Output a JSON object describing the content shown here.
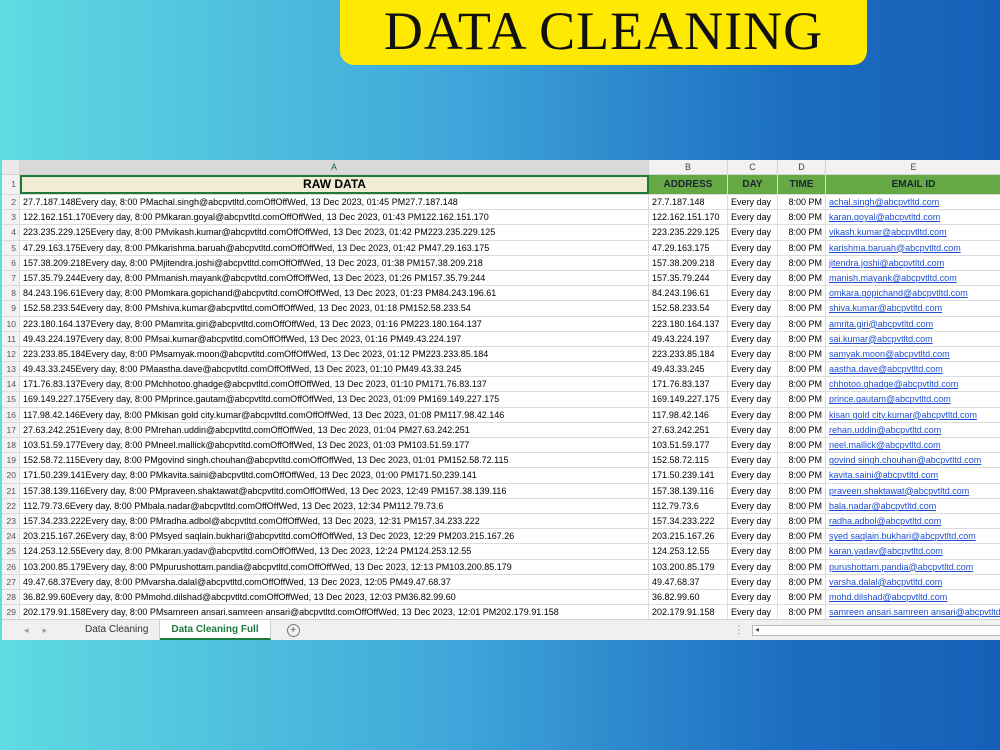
{
  "banner": {
    "title": "DATA CLEANING"
  },
  "columns": [
    "A",
    "B",
    "C",
    "D",
    "E"
  ],
  "header_row": {
    "number": "1",
    "raw": "RAW DATA",
    "address": "ADDRESS",
    "day": "DAY",
    "time": "TIME",
    "email": "EMAIL ID"
  },
  "rows": [
    {
      "n": "2",
      "raw": "27.7.187.148Every day, 8:00 PMachal.singh@abcpvtltd.comOffOffWed, 13 Dec 2023, 01:45 PM27.7.187.148",
      "address": "27.7.187.148",
      "day": "Every day",
      "time": "8:00 PM",
      "email": "achal.singh@abcpvtltd.com"
    },
    {
      "n": "3",
      "raw": "122.162.151.170Every day, 8:00 PMkaran.goyal@abcpvtltd.comOffOffWed, 13 Dec 2023, 01:43 PM122.162.151.170",
      "address": "122.162.151.170",
      "day": "Every day",
      "time": "8:00 PM",
      "email": "karan.goyal@abcpvtltd.com"
    },
    {
      "n": "4",
      "raw": "223.235.229.125Every day, 8:00 PMvikash.kumar@abcpvtltd.comOffOffWed, 13 Dec 2023, 01:42 PM223.235.229.125",
      "address": "223.235.229.125",
      "day": "Every day",
      "time": "8:00 PM",
      "email": "vikash.kumar@abcpvtltd.com"
    },
    {
      "n": "5",
      "raw": "47.29.163.175Every day, 8:00 PMkarishma.baruah@abcpvtltd.comOffOffWed, 13 Dec 2023, 01:42 PM47.29.163.175",
      "address": "47.29.163.175",
      "day": "Every day",
      "time": "8:00 PM",
      "email": "karishma.baruah@abcpvtltd.com"
    },
    {
      "n": "6",
      "raw": "157.38.209.218Every day, 8:00 PMjitendra.joshi@abcpvtltd.comOffOffWed, 13 Dec 2023, 01:38 PM157.38.209.218",
      "address": "157.38.209.218",
      "day": "Every day",
      "time": "8:00 PM",
      "email": "jitendra.joshi@abcpvtltd.com"
    },
    {
      "n": "7",
      "raw": "157.35.79.244Every day, 8:00 PMmanish.mayank@abcpvtltd.comOffOffWed, 13 Dec 2023, 01:26 PM157.35.79.244",
      "address": "157.35.79.244",
      "day": "Every day",
      "time": "8:00 PM",
      "email": "manish.mayank@abcpvtltd.com"
    },
    {
      "n": "8",
      "raw": "84.243.196.61Every day, 8:00 PMomkara.gopichand@abcpvtltd.comOffOffWed, 13 Dec 2023, 01:23 PM84.243.196.61",
      "address": "84.243.196.61",
      "day": "Every day",
      "time": "8:00 PM",
      "email": "omkara.gopichand@abcpvtltd.com"
    },
    {
      "n": "9",
      "raw": "152.58.233.54Every day, 8:00 PMshiva.kumar@abcpvtltd.comOffOffWed, 13 Dec 2023, 01:18 PM152.58.233.54",
      "address": "152.58.233.54",
      "day": "Every day",
      "time": "8:00 PM",
      "email": "shiva.kumar@abcpvtltd.com"
    },
    {
      "n": "10",
      "raw": "223.180.164.137Every day, 8:00 PMamrita.giri@abcpvtltd.comOffOffWed, 13 Dec 2023, 01:16 PM223.180.164.137",
      "address": "223.180.164.137",
      "day": "Every day",
      "time": "8:00 PM",
      "email": "amrita.giri@abcpvtltd.com"
    },
    {
      "n": "11",
      "raw": "49.43.224.197Every day, 8:00 PMsai.kumar@abcpvtltd.comOffOffWed, 13 Dec 2023, 01:16 PM49.43.224.197",
      "address": "49.43.224.197",
      "day": "Every day",
      "time": "8:00 PM",
      "email": "sai.kumar@abcpvtltd.com"
    },
    {
      "n": "12",
      "raw": "223.233.85.184Every day, 8:00 PMsamyak.moon@abcpvtltd.comOffOffWed, 13 Dec 2023, 01:12 PM223.233.85.184",
      "address": "223.233.85.184",
      "day": "Every day",
      "time": "8:00 PM",
      "email": "samyak.moon@abcpvtltd.com"
    },
    {
      "n": "13",
      "raw": "49.43.33.245Every day, 8:00 PMaastha.dave@abcpvtltd.comOffOffWed, 13 Dec 2023, 01:10 PM49.43.33.245",
      "address": "49.43.33.245",
      "day": "Every day",
      "time": "8:00 PM",
      "email": "aastha.dave@abcpvtltd.com"
    },
    {
      "n": "14",
      "raw": "171.76.83.137Every day, 8:00 PMchhotoo.ghadge@abcpvtltd.comOffOffWed, 13 Dec 2023, 01:10 PM171.76.83.137",
      "address": "171.76.83.137",
      "day": "Every day",
      "time": "8:00 PM",
      "email": "chhotoo.ghadge@abcpvtltd.com"
    },
    {
      "n": "15",
      "raw": "169.149.227.175Every day, 8:00 PMprince.gautam@abcpvtltd.comOffOffWed, 13 Dec 2023, 01:09 PM169.149.227.175",
      "address": "169.149.227.175",
      "day": "Every day",
      "time": "8:00 PM",
      "email": "prince.gautam@abcpvtltd.com"
    },
    {
      "n": "16",
      "raw": "117.98.42.146Every day, 8:00 PMkisan gold city.kumar@abcpvtltd.comOffOffWed, 13 Dec 2023, 01:08 PM117.98.42.146",
      "address": "117.98.42.146",
      "day": "Every day",
      "time": "8:00 PM",
      "email": "kisan gold city.kumar@abcpvtltd.com"
    },
    {
      "n": "17",
      "raw": "27.63.242.251Every day, 8:00 PMrehan.uddin@abcpvtltd.comOffOffWed, 13 Dec 2023, 01:04 PM27.63.242.251",
      "address": "27.63.242.251",
      "day": "Every day",
      "time": "8:00 PM",
      "email": "rehan.uddin@abcpvtltd.com"
    },
    {
      "n": "18",
      "raw": "103.51.59.177Every day, 8:00 PMneel.mallick@abcpvtltd.comOffOffWed, 13 Dec 2023, 01:03 PM103.51.59.177",
      "address": "103.51.59.177",
      "day": "Every day",
      "time": "8:00 PM",
      "email": "neel.mallick@abcpvtltd.com"
    },
    {
      "n": "19",
      "raw": "152.58.72.115Every day, 8:00 PMgovind singh.chouhan@abcpvtltd.comOffOffWed, 13 Dec 2023, 01:01 PM152.58.72.115",
      "address": "152.58.72.115",
      "day": "Every day",
      "time": "8:00 PM",
      "email": "govind singh.chouhan@abcpvtltd.com"
    },
    {
      "n": "20",
      "raw": "171.50.239.141Every day, 8:00 PMkavita.saini@abcpvtltd.comOffOffWed, 13 Dec 2023, 01:00 PM171.50.239.141",
      "address": "171.50.239.141",
      "day": "Every day",
      "time": "8:00 PM",
      "email": "kavita.saini@abcpvtltd.com"
    },
    {
      "n": "21",
      "raw": "157.38.139.116Every day, 8:00 PMpraveen.shaktawat@abcpvtltd.comOffOffWed, 13 Dec 2023, 12:49 PM157.38.139.116",
      "address": "157.38.139.116",
      "day": "Every day",
      "time": "8:00 PM",
      "email": "praveen.shaktawat@abcpvtltd.com"
    },
    {
      "n": "22",
      "raw": "112.79.73.6Every day, 8:00 PMbala.nadar@abcpvtltd.comOffOffWed, 13 Dec 2023, 12:34 PM112.79.73.6",
      "address": "112.79.73.6",
      "day": "Every day",
      "time": "8:00 PM",
      "email": "bala.nadar@abcpvtltd.com"
    },
    {
      "n": "23",
      "raw": "157.34.233.222Every day, 8:00 PMradha.adbol@abcpvtltd.comOffOffWed, 13 Dec 2023, 12:31 PM157.34.233.222",
      "address": "157.34.233.222",
      "day": "Every day",
      "time": "8:00 PM",
      "email": "radha.adbol@abcpvtltd.com"
    },
    {
      "n": "24",
      "raw": "203.215.167.26Every day, 8:00 PMsyed saqlain.bukhari@abcpvtltd.comOffOffWed, 13 Dec 2023, 12:29 PM203.215.167.26",
      "address": "203.215.167.26",
      "day": "Every day",
      "time": "8:00 PM",
      "email": "syed saqlain.bukhari@abcpvtltd.com"
    },
    {
      "n": "25",
      "raw": "124.253.12.55Every day, 8:00 PMkaran.yadav@abcpvtltd.comOffOffWed, 13 Dec 2023, 12:24 PM124.253.12.55",
      "address": "124.253.12.55",
      "day": "Every day",
      "time": "8:00 PM",
      "email": "karan.yadav@abcpvtltd.com"
    },
    {
      "n": "26",
      "raw": "103.200.85.179Every day, 8:00 PMpurushottam.pandia@abcpvtltd.comOffOffWed, 13 Dec 2023, 12:13 PM103.200.85.179",
      "address": "103.200.85.179",
      "day": "Every day",
      "time": "8:00 PM",
      "email": "purushottam.pandia@abcpvtltd.com"
    },
    {
      "n": "27",
      "raw": "49.47.68.37Every day, 8:00 PMvarsha.dalal@abcpvtltd.comOffOffWed, 13 Dec 2023, 12:05 PM49.47.68.37",
      "address": "49.47.68.37",
      "day": "Every day",
      "time": "8:00 PM",
      "email": "varsha.dalal@abcpvtltd.com"
    },
    {
      "n": "28",
      "raw": "36.82.99.60Every day, 8:00 PMmohd.dilshad@abcpvtltd.comOffOffWed, 13 Dec 2023, 12:03 PM36.82.99.60",
      "address": "36.82.99.60",
      "day": "Every day",
      "time": "8:00 PM",
      "email": "mohd.dilshad@abcpvtltd.com"
    },
    {
      "n": "29",
      "raw": "202.179.91.158Every day, 8:00 PMsamreen ansari.samreen ansari@abcpvtltd.comOffOffWed, 13 Dec 2023, 12:01 PM202.179.91.158",
      "address": "202.179.91.158",
      "day": "Every day",
      "time": "8:00 PM",
      "email": "samreen ansari.samreen ansari@abcpvtltd.com"
    }
  ],
  "tabs": {
    "nav_prev": "◂",
    "nav_next": "▸",
    "sheet1": "Data Cleaning",
    "sheet2": "Data Cleaning Full",
    "add": "+",
    "scroll_dots": "⋮",
    "scroll_left": "◂"
  },
  "colors": {
    "banner": "#fde902",
    "header_green": "#66a844",
    "active_tab": "#1e7a3c",
    "link": "#1f4fd0"
  }
}
